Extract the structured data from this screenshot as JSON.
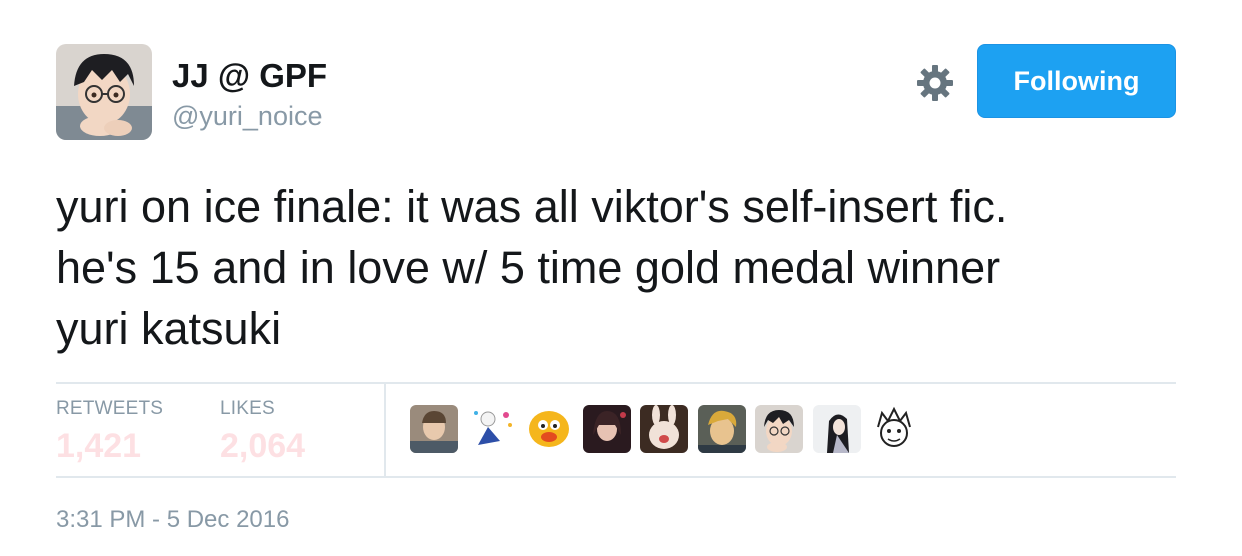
{
  "tweet": {
    "author": {
      "display_name": "JJ @ GPF",
      "handle": "@yuri_noice"
    },
    "follow_button_label": "Following",
    "text": "yuri on ice finale: it was all viktor's self-insert fic.\nhe's 15 and in love w/ 5 time gold medal winner\nyuri katsuki",
    "stats": {
      "retweets_label": "RETWEETS",
      "retweets_count": "1,421",
      "likes_label": "LIKES",
      "likes_count": "2,064"
    },
    "timestamp": "3:31 PM - 5 Dec 2016"
  },
  "colors": {
    "accent": "#1da1f2",
    "muted_text": "#8899a6",
    "stat_value": "#fde0e3",
    "divider": "#e1e8ed"
  },
  "icons": [
    "gear-icon"
  ]
}
